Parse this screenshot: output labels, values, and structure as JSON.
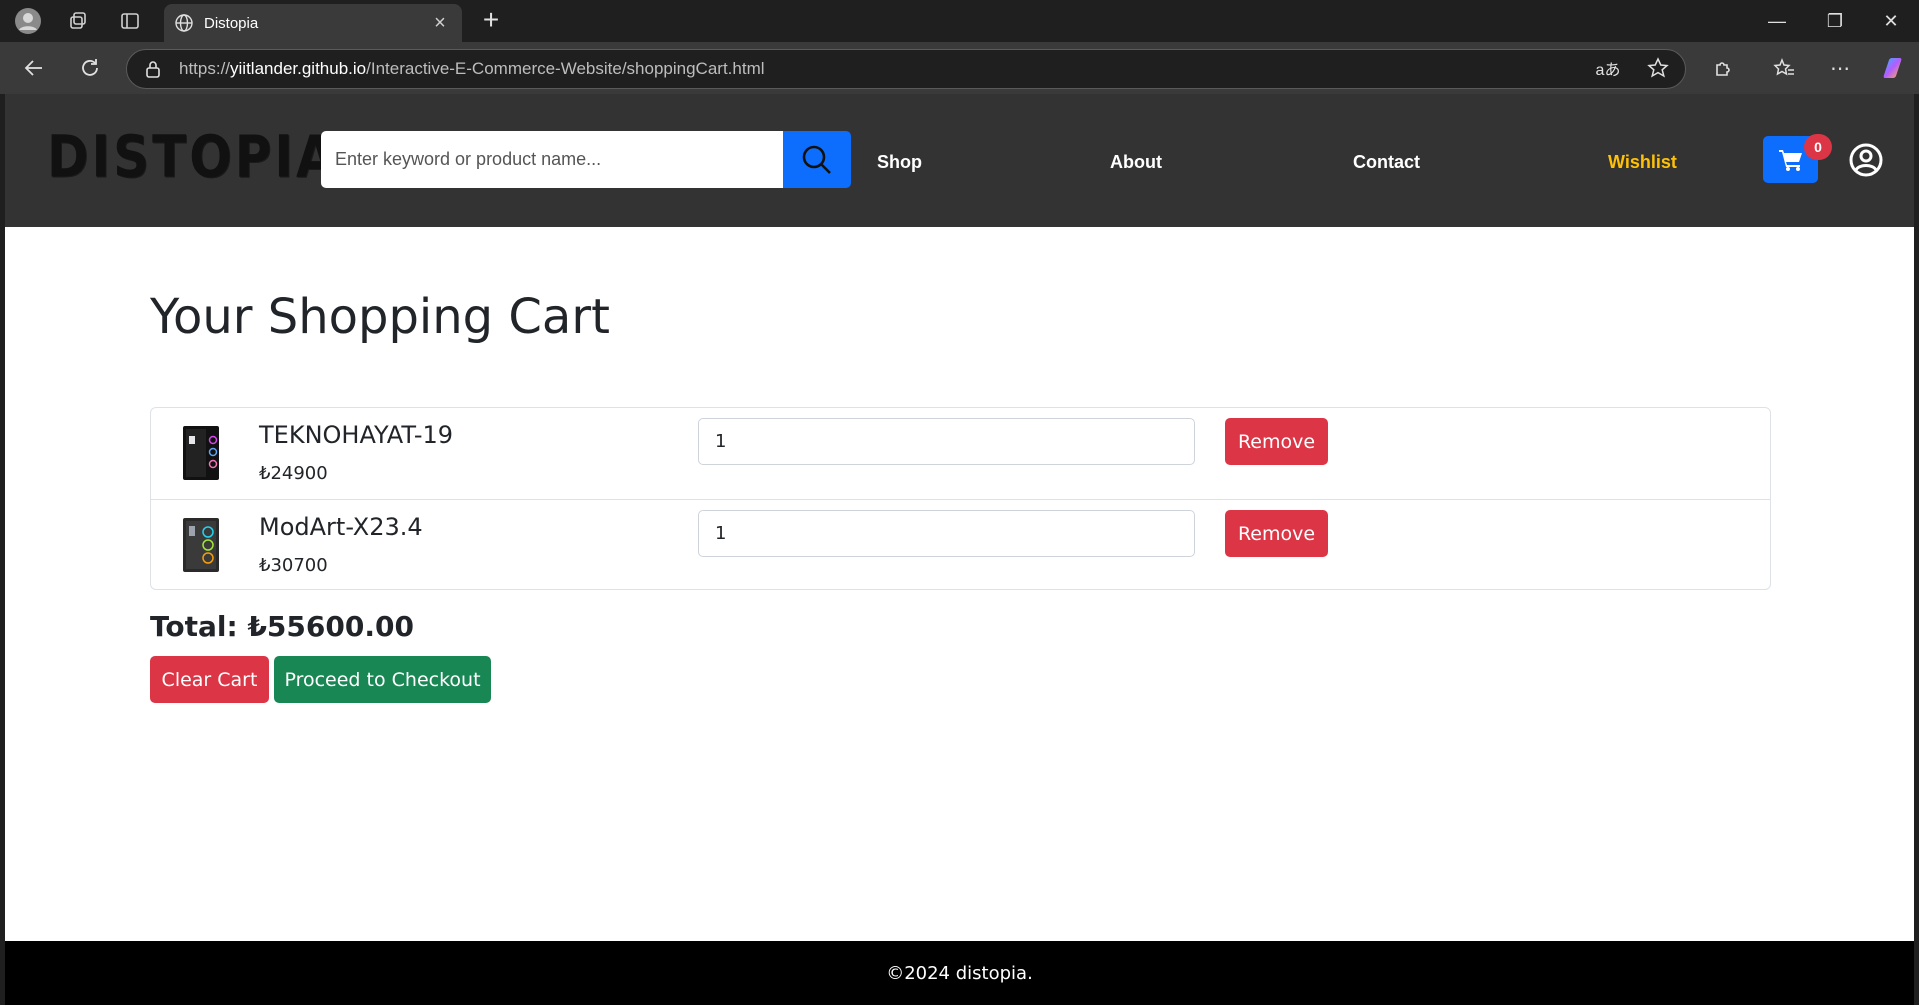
{
  "browser": {
    "tab_title": "Distopia",
    "url_scheme": "https://",
    "url_host": "yiitlander.github.io",
    "url_path": "/Interactive-E-Commerce-Website/shoppingCart.html"
  },
  "header": {
    "logo": "DISTOPIA",
    "search_placeholder": "Enter keyword or product name...",
    "nav": {
      "shop": "Shop",
      "about": "About",
      "contact": "Contact",
      "wishlist": "Wishlist"
    },
    "cart_count": "0",
    "colors": {
      "accent": "#0d6efd",
      "wishlist": "#ffc107",
      "badge": "#dc3545"
    }
  },
  "main": {
    "title": "Your Shopping Cart",
    "items": [
      {
        "name": "TEKNOHAYAT-19",
        "price": "₺24900",
        "quantity": "1",
        "remove_label": "Remove",
        "icon": "pc-case-icon"
      },
      {
        "name": "ModArt-X23.4",
        "price": "₺30700",
        "quantity": "1",
        "remove_label": "Remove",
        "icon": "pc-case-icon"
      }
    ],
    "total": "Total: ₺55600.00",
    "clear_label": "Clear Cart",
    "checkout_label": "Proceed to Checkout"
  },
  "footer": {
    "text": "©2024 distopia."
  }
}
